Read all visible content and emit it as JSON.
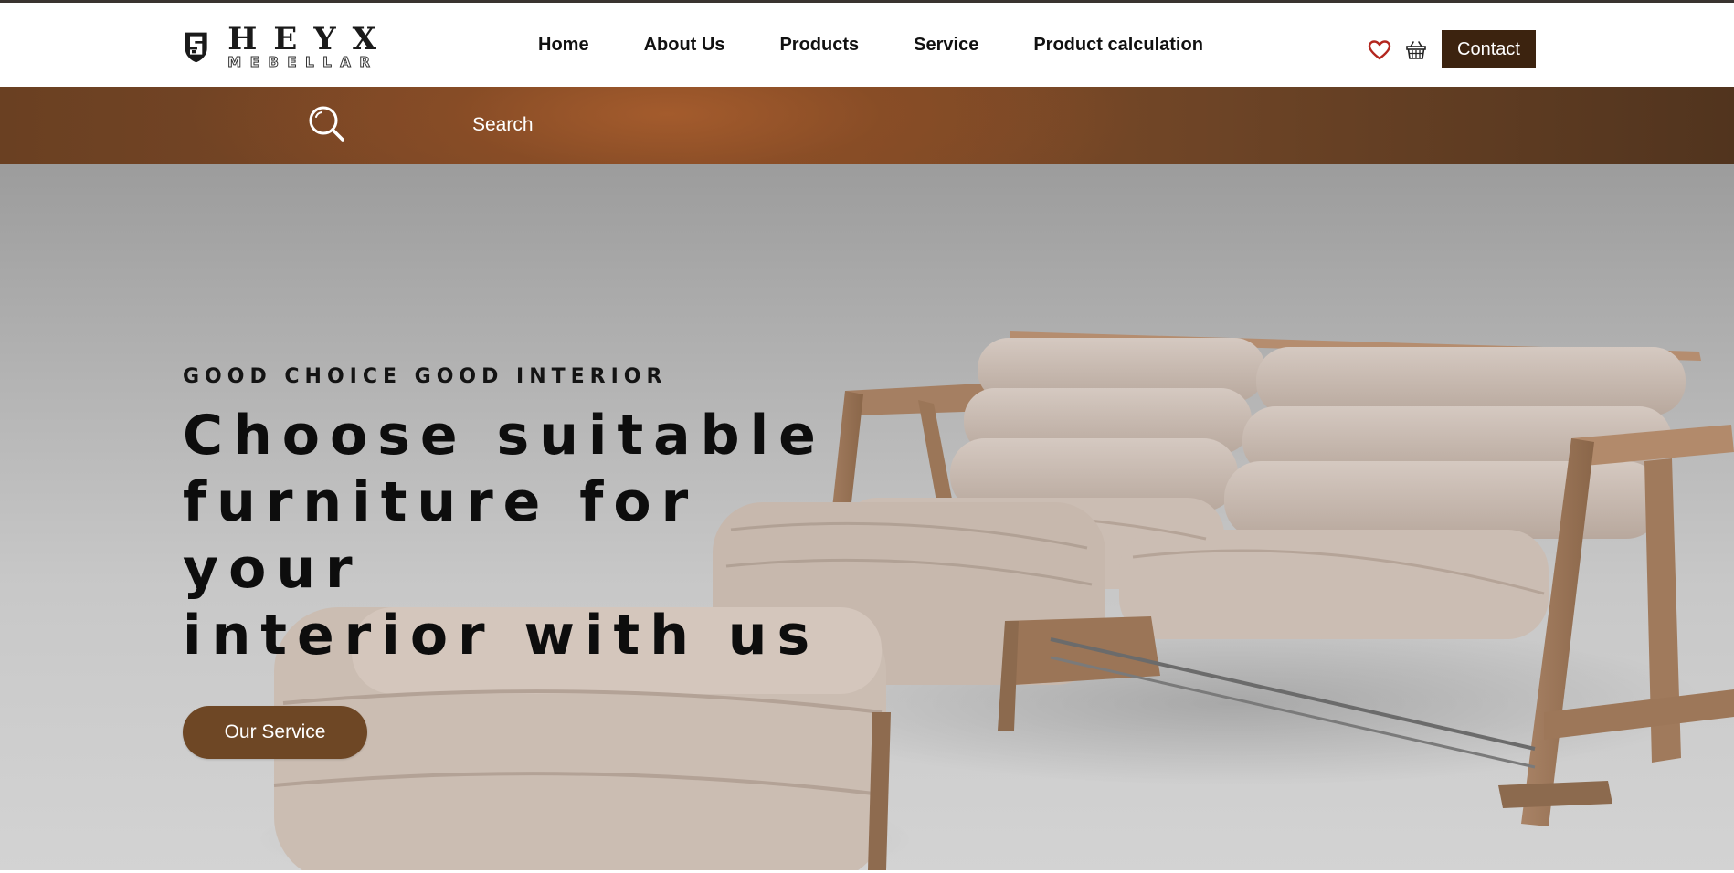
{
  "brand": {
    "name": "HEYX",
    "sub": "MEBELLAR"
  },
  "nav": {
    "items": [
      {
        "label": "Home"
      },
      {
        "label": "About Us"
      },
      {
        "label": "Products"
      },
      {
        "label": "Service"
      },
      {
        "label": "Product calculation"
      }
    ]
  },
  "header": {
    "icons": [
      "heart-icon",
      "basket-icon"
    ],
    "contact_label": "Contact"
  },
  "search": {
    "placeholder": "Search",
    "value": ""
  },
  "hero": {
    "kicker": "GOOD CHOICE GOOD INTERIOR",
    "title_lines": [
      "Choose suitable",
      "furniture for your",
      "interior with us"
    ],
    "cta_label": "Our Service"
  },
  "colors": {
    "brand_dark": "#3c230f",
    "cta": "#6e4725",
    "search_bar": "#8a4e28",
    "heart": "#b3261e"
  }
}
